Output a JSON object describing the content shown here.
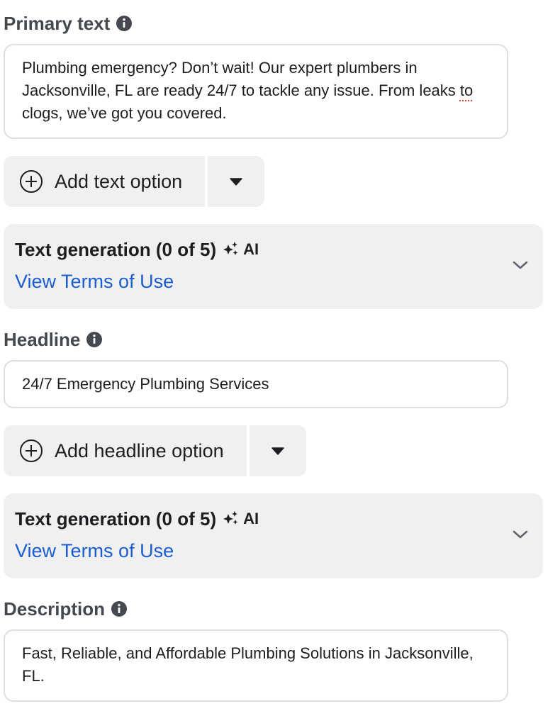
{
  "primary_text": {
    "label": "Primary text",
    "value_part1": "Plumbing emergency? Don’t wait! Our expert plumbers in Jacksonville, FL are ready 24/7 to tackle any issue. From leaks ",
    "value_misspelled": "to",
    "value_part2": " clogs, we’ve got you covered.",
    "add_option_label": "Add text option"
  },
  "primary_generation": {
    "title": "Text generation (0 of 5)",
    "ai_label": "AI",
    "link": "View Terms of Use"
  },
  "headline": {
    "label": "Headline",
    "value": "24/7 Emergency Plumbing Services",
    "add_option_label": "Add headline option"
  },
  "headline_generation": {
    "title": "Text generation (0 of 5)",
    "ai_label": "AI",
    "link": "View Terms of Use"
  },
  "description": {
    "label": "Description",
    "value": "Fast, Reliable, and Affordable Plumbing Solutions in Jacksonville, FL."
  },
  "icons": {
    "info": "info-icon",
    "plus": "plus-circle-icon",
    "caret": "caret-down-icon",
    "sparkle": "ai-sparkle-icon",
    "chevron": "chevron-down-icon"
  },
  "colors": {
    "link": "#1b5ed0",
    "panel_bg": "#f0f0f0",
    "border": "#dddfe2",
    "label": "#444950"
  }
}
